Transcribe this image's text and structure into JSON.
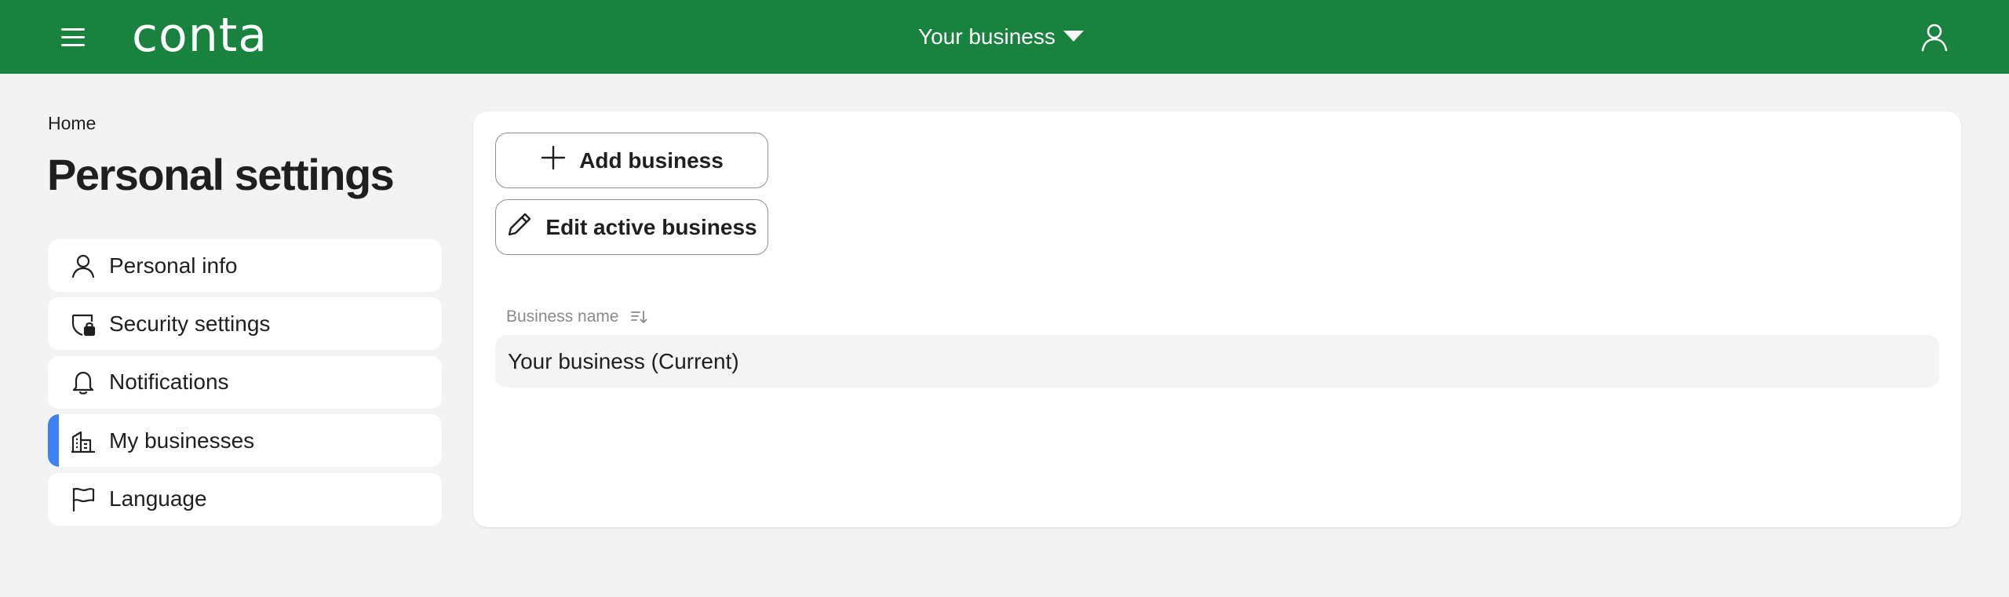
{
  "header": {
    "logo_text": "conta",
    "business_switcher_label": "Your business",
    "colors": {
      "brand_green": "#18823e",
      "active_accent": "#3b82f6"
    },
    "icons": [
      "menu-icon",
      "chevron-down-icon",
      "user-icon"
    ]
  },
  "breadcrumb": {
    "home": "Home"
  },
  "page": {
    "title": "Personal settings"
  },
  "sidebar": {
    "items": [
      {
        "label": "Personal info",
        "icon": "person-icon",
        "active": false
      },
      {
        "label": "Security settings",
        "icon": "shield-lock-icon",
        "active": false
      },
      {
        "label": "Notifications",
        "icon": "bell-icon",
        "active": false
      },
      {
        "label": "My businesses",
        "icon": "buildings-icon",
        "active": true
      },
      {
        "label": "Language",
        "icon": "flag-icon",
        "active": false
      }
    ]
  },
  "main": {
    "add_business_label": "Add business",
    "edit_business_label": "Edit active business",
    "table": {
      "columns": [
        "Business name"
      ],
      "rows": [
        {
          "business_name": "Your business (Current)"
        }
      ]
    }
  }
}
